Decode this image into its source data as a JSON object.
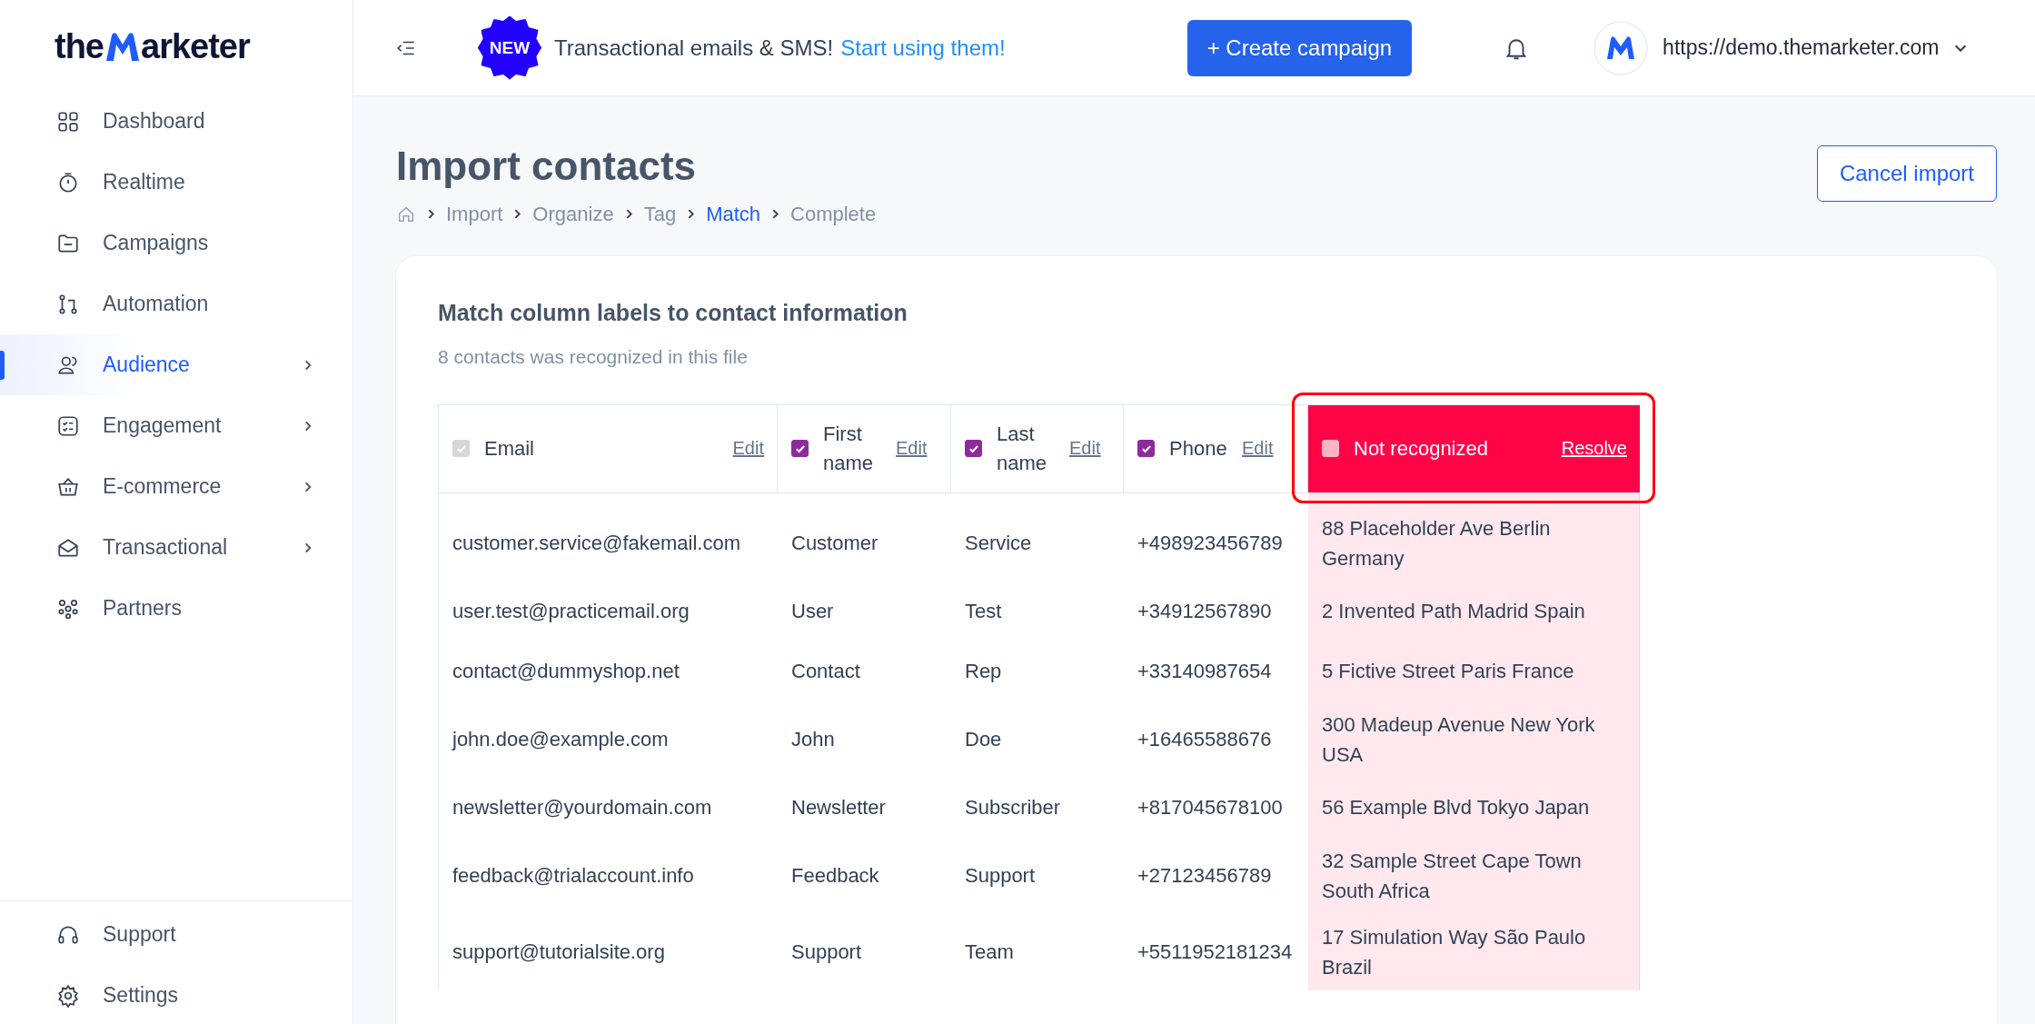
{
  "sidebar": {
    "logo_left": "the",
    "logo_right": "arketer",
    "items": [
      {
        "label": "Dashboard",
        "selected": false,
        "has_submenu": false
      },
      {
        "label": "Realtime",
        "selected": false,
        "has_submenu": false
      },
      {
        "label": "Campaigns",
        "selected": false,
        "has_submenu": false
      },
      {
        "label": "Automation",
        "selected": false,
        "has_submenu": false
      },
      {
        "label": "Audience",
        "selected": true,
        "has_submenu": true
      },
      {
        "label": "Engagement",
        "selected": false,
        "has_submenu": true
      },
      {
        "label": "E-commerce",
        "selected": false,
        "has_submenu": true
      },
      {
        "label": "Transactional",
        "selected": false,
        "has_submenu": true
      },
      {
        "label": "Partners",
        "selected": false,
        "has_submenu": false
      }
    ],
    "footer_items": [
      {
        "label": "Support"
      },
      {
        "label": "Settings"
      }
    ]
  },
  "header": {
    "badge": "NEW",
    "announcement": "Transactional emails & SMS!",
    "announcement_link": "Start using them!",
    "create_button": "+ Create campaign",
    "account_url": "https://demo.themarketer.com"
  },
  "page": {
    "title": "Import contacts",
    "cancel_button": "Cancel import",
    "breadcrumb": [
      {
        "label": "Import",
        "selected": false
      },
      {
        "label": "Organize",
        "selected": false
      },
      {
        "label": "Tag",
        "selected": false
      },
      {
        "label": "Match",
        "selected": true
      },
      {
        "label": "Complete",
        "selected": false
      }
    ]
  },
  "card": {
    "title": "Match column labels to contact information",
    "subtitle": "8 contacts was recognized in this file",
    "columns": [
      {
        "label": "Email",
        "kind": "recognized",
        "checked": true,
        "disabled": true,
        "action": "Edit"
      },
      {
        "label": "First name",
        "kind": "recognized",
        "checked": true,
        "disabled": false,
        "action": "Edit"
      },
      {
        "label": "Last name",
        "kind": "recognized",
        "checked": true,
        "disabled": false,
        "action": "Edit"
      },
      {
        "label": "Phone",
        "kind": "recognized",
        "checked": true,
        "disabled": false,
        "action": "Edit"
      },
      {
        "label": "Not recognized",
        "kind": "unrecognized",
        "checked": false,
        "disabled": false,
        "action": "Resolve"
      }
    ],
    "rows": [
      [
        "customer.service@fakemail.com",
        "Customer",
        "Service",
        "+498923456789",
        "88 Placeholder Ave Berlin Germany"
      ],
      [
        "user.test@practicemail.org",
        "User",
        "Test",
        "+34912567890",
        "2 Invented Path Madrid Spain"
      ],
      [
        "contact@dummyshop.net",
        "Contact",
        "Rep",
        "+33140987654",
        "5 Fictive Street Paris France"
      ],
      [
        "john.doe@example.com",
        "John",
        "Doe",
        "+16465588676",
        "300 Madeup Avenue New York USA"
      ],
      [
        "newsletter@yourdomain.com",
        "Newsletter",
        "Subscriber",
        "+817045678100",
        "56 Example Blvd Tokyo Japan"
      ],
      [
        "feedback@trialaccount.info",
        "Feedback",
        "Support",
        "+27123456789",
        "32 Sample Street Cape Town South Africa"
      ],
      [
        "support@tutorialsite.org",
        "Support",
        "Team",
        "+5511952181234",
        "17 Simulation Way São Paulo Brazil"
      ]
    ]
  }
}
